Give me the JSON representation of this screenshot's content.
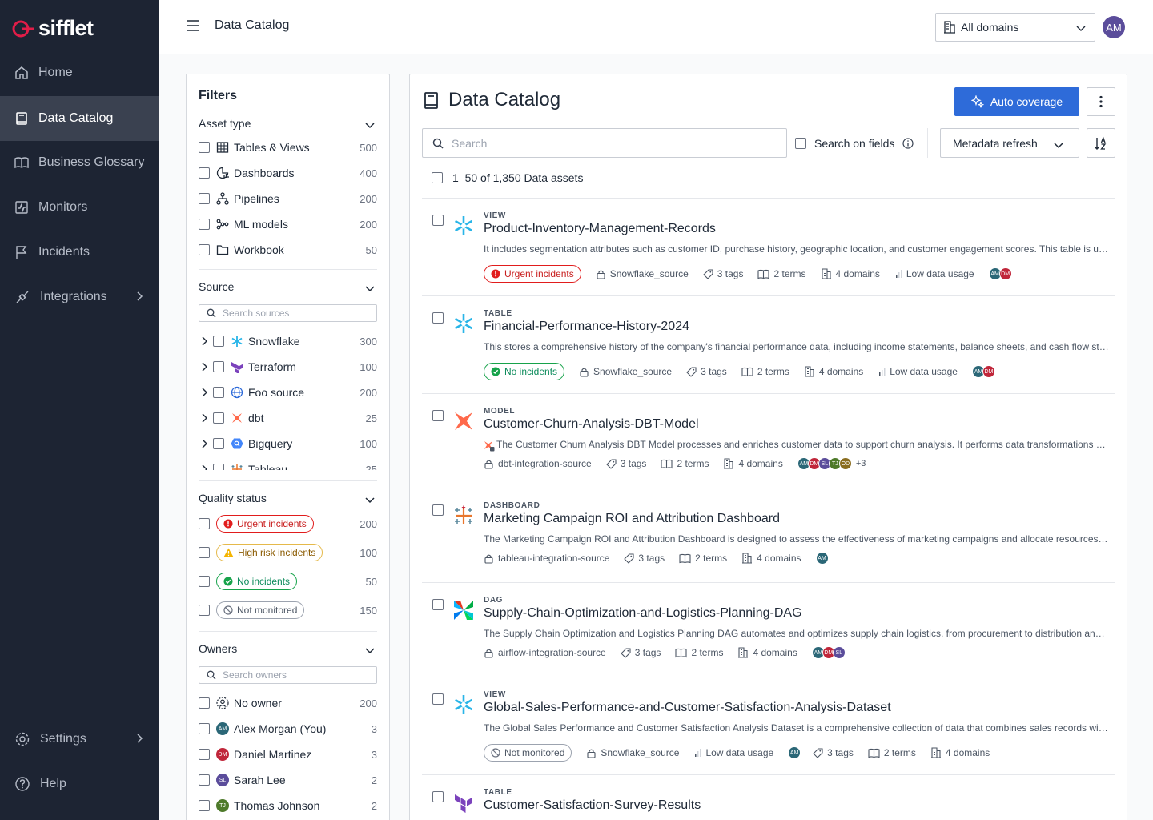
{
  "brand": {
    "name": "sifflet",
    "accent": "#e11d48"
  },
  "sidebar": {
    "items": [
      {
        "label": "Home",
        "icon": "home-icon"
      },
      {
        "label": "Data Catalog",
        "icon": "book-icon",
        "active": true
      },
      {
        "label": "Business Glossary",
        "icon": "open-book-icon"
      },
      {
        "label": "Monitors",
        "icon": "monitor-icon"
      },
      {
        "label": "Incidents",
        "icon": "flag-icon"
      },
      {
        "label": "Integrations",
        "icon": "plug-icon"
      }
    ],
    "bottom": [
      {
        "label": "Settings",
        "icon": "gear-icon"
      },
      {
        "label": "Help",
        "icon": "help-icon"
      }
    ]
  },
  "header": {
    "title": "Data Catalog",
    "domain_select": "All domains",
    "user_initials": "AM"
  },
  "filters": {
    "title": "Filters",
    "asset_type": {
      "label": "Asset type",
      "items": [
        {
          "label": "Tables & Views",
          "count": "500"
        },
        {
          "label": "Dashboards",
          "count": "400"
        },
        {
          "label": "Pipelines",
          "count": "200"
        },
        {
          "label": "ML models",
          "count": "200"
        },
        {
          "label": "Workbook",
          "count": "50"
        }
      ]
    },
    "source": {
      "label": "Source",
      "search_placeholder": "Search sources",
      "items": [
        {
          "label": "Snowflake",
          "count": "300"
        },
        {
          "label": "Terraform",
          "count": "100"
        },
        {
          "label": "Foo source",
          "count": "200"
        },
        {
          "label": "dbt",
          "count": "25"
        },
        {
          "label": "Bigquery",
          "count": "100"
        },
        {
          "label": "Tableau",
          "count": "25"
        }
      ]
    },
    "quality_status": {
      "label": "Quality status",
      "items": [
        {
          "label": "Urgent incidents",
          "count": "200"
        },
        {
          "label": "High risk incidents",
          "count": "100"
        },
        {
          "label": "No incidents",
          "count": "50"
        },
        {
          "label": "Not monitored",
          "count": "150"
        }
      ]
    },
    "owners": {
      "label": "Owners",
      "search_placeholder": "Search owners",
      "items": [
        {
          "label": "No owner",
          "count": "200",
          "initials": ""
        },
        {
          "label": "Alex Morgan (You)",
          "count": "3",
          "initials": "AM",
          "color": "#2b6777"
        },
        {
          "label": "Daniel Martinez",
          "count": "3",
          "initials": "DM",
          "color": "#c0263a"
        },
        {
          "label": "Sarah Lee",
          "count": "2",
          "initials": "SL",
          "color": "#5b4d9b"
        },
        {
          "label": "Thomas Johnson",
          "count": "2",
          "initials": "TJ",
          "color": "#4e7a2a"
        }
      ]
    }
  },
  "catalog": {
    "title": "Data Catalog",
    "auto_coverage": "Auto coverage",
    "search_placeholder": "Search",
    "search_on_fields": "Search on fields",
    "metadata_refresh": "Metadata refresh",
    "count_text": "1–50 of 1,350 Data assets",
    "assets": [
      {
        "type": "VIEW",
        "name": "Product-Inventory-Management-Records",
        "desc": "It includes segmentation attributes such as customer ID, purchase history, geographic location, and customer engagement scores. This table is used for targeted marketing campaigns.",
        "status": "Urgent incidents",
        "source": "Snowflake_source",
        "tags": "3 tags",
        "terms": "2 terms",
        "domains": "4 domains",
        "usage": "Low data usage",
        "avatars": [
          "AM",
          "DM"
        ]
      },
      {
        "type": "TABLE",
        "name": "Financial-Performance-History-2024",
        "desc": "This stores a comprehensive history of the company's financial performance data, including income statements, balance sheets, and cash flow statements.",
        "status": "No incidents",
        "source": "Snowflake_source",
        "tags": "3 tags",
        "terms": "2 terms",
        "domains": "4 domains",
        "usage": "Low data usage",
        "avatars": [
          "AM",
          "DM"
        ]
      },
      {
        "type": "MODEL",
        "name": "Customer-Churn-Analysis-DBT-Model",
        "desc": "The Customer Churn Analysis DBT Model processes and enriches customer data to support churn analysis. It performs data transformations and aggregations.",
        "source": "dbt-integration-source",
        "tags": "3 tags",
        "terms": "2 terms",
        "domains": "4 domains",
        "avatars": [
          "AM",
          "DM",
          "SL",
          "TJ",
          "OD"
        ],
        "more": "+3"
      },
      {
        "type": "DASHBOARD",
        "name": "Marketing Campaign ROI and Attribution Dashboard",
        "desc": "The Marketing Campaign ROI and Attribution Dashboard is designed to assess the effectiveness of marketing campaigns and allocate resources accordingly.",
        "source": "tableau-integration-source",
        "tags": "3 tags",
        "terms": "2 terms",
        "domains": "4 domains",
        "avatars": [
          "AM"
        ]
      },
      {
        "type": "DAG",
        "name": "Supply-Chain-Optimization-and-Logistics-Planning-DAG",
        "desc": "The Supply Chain Optimization and Logistics Planning DAG automates and optimizes supply chain logistics, from procurement to distribution and delivery.",
        "source": "airflow-integration-source",
        "tags": "3 tags",
        "terms": "2 terms",
        "domains": "4 domains",
        "avatars": [
          "AM",
          "DM",
          "SL"
        ]
      },
      {
        "type": "VIEW",
        "name": "Global-Sales-Performance-and-Customer-Satisfaction-Analysis-Dataset",
        "desc": "The Global Sales Performance and Customer Satisfaction Analysis Dataset is a comprehensive collection of data that combines sales records with customer feedback.",
        "status": "Not monitored",
        "source": "Snowflake_source",
        "usage": "Low data usage",
        "avatars": [
          "AM"
        ],
        "tags": "3 tags",
        "terms": "2 terms",
        "domains": "4 domains"
      },
      {
        "type": "TABLE",
        "name": "Customer-Satisfaction-Survey-Results"
      }
    ]
  },
  "colors": {
    "sidebar_bg": "#1d2433",
    "primary": "#2e6bd9",
    "urgent": "#e11d1d",
    "ok": "#16a34a",
    "warn": "#e5b94a"
  }
}
